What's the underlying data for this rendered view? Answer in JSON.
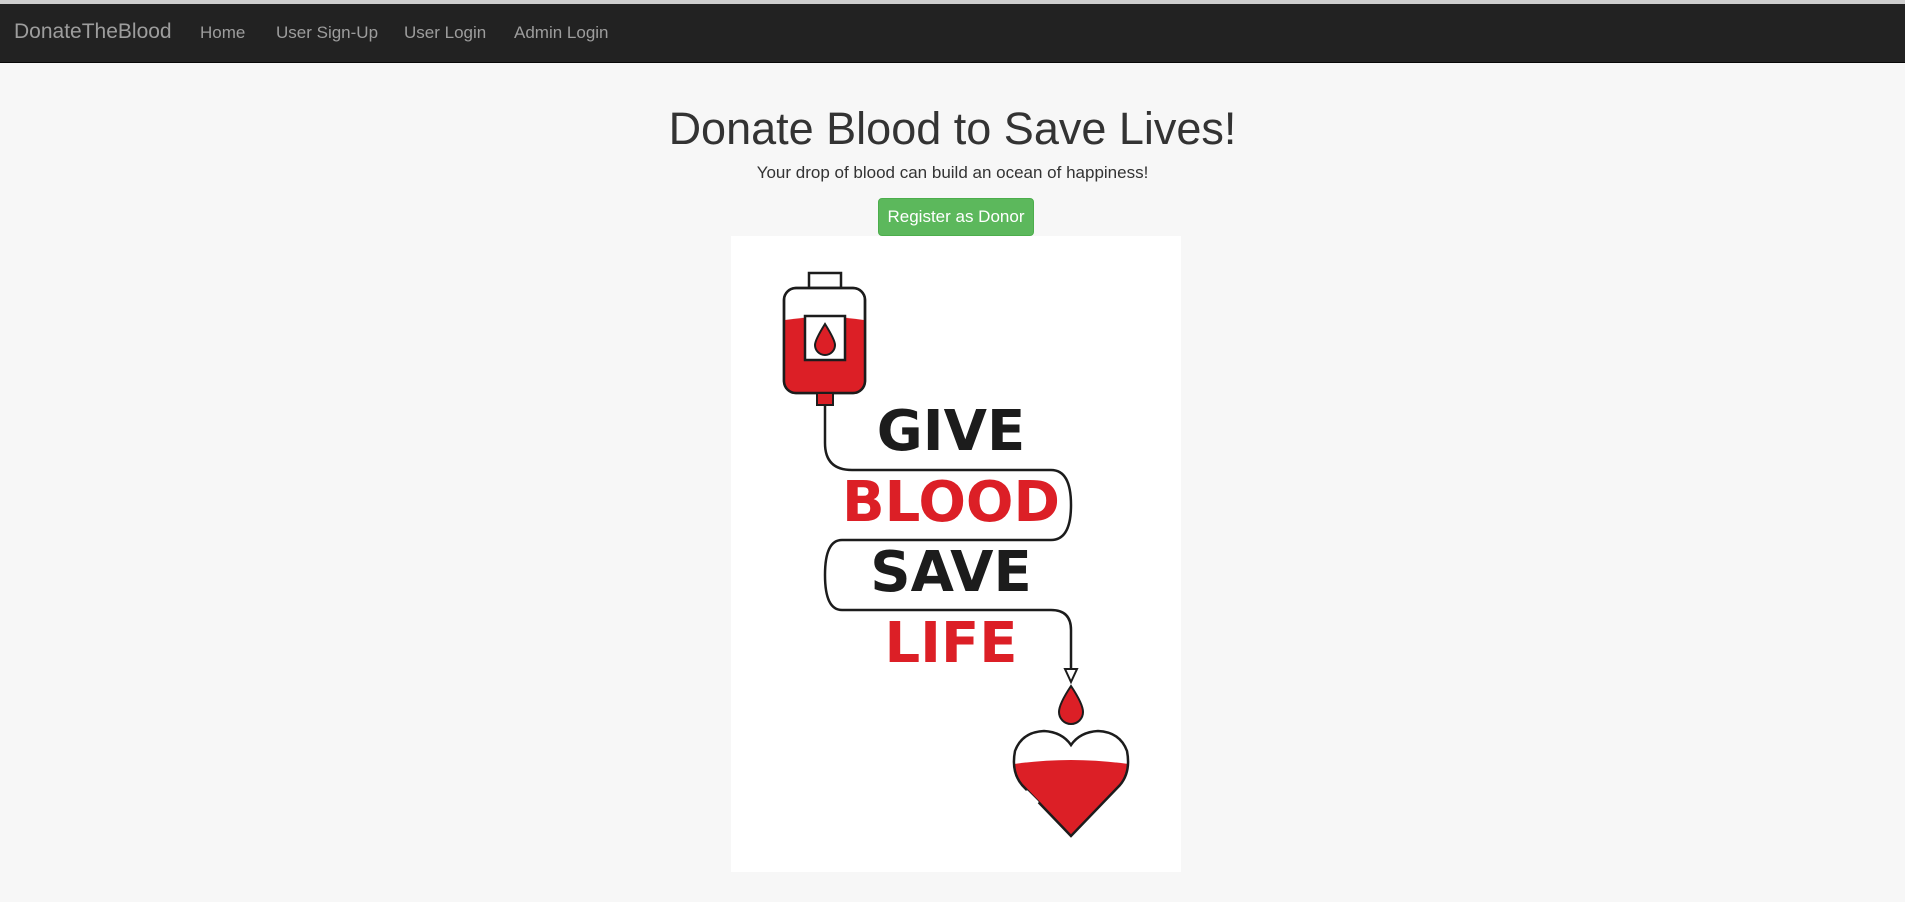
{
  "navbar": {
    "brand": "DonateTheBlood",
    "links": [
      "Home",
      "User Sign-Up",
      "User Login",
      "Admin Login"
    ]
  },
  "hero": {
    "title": "Donate Blood to Save Lives!",
    "subtitle": "Your drop of blood can build an ocean of happiness!",
    "button_label": "Register as Donor"
  },
  "poster": {
    "lines": [
      "GIVE",
      "BLOOD",
      "SAVE",
      "LIFE"
    ],
    "colors": {
      "dark": "#1c1c1c",
      "red": "#dc1f26"
    }
  }
}
